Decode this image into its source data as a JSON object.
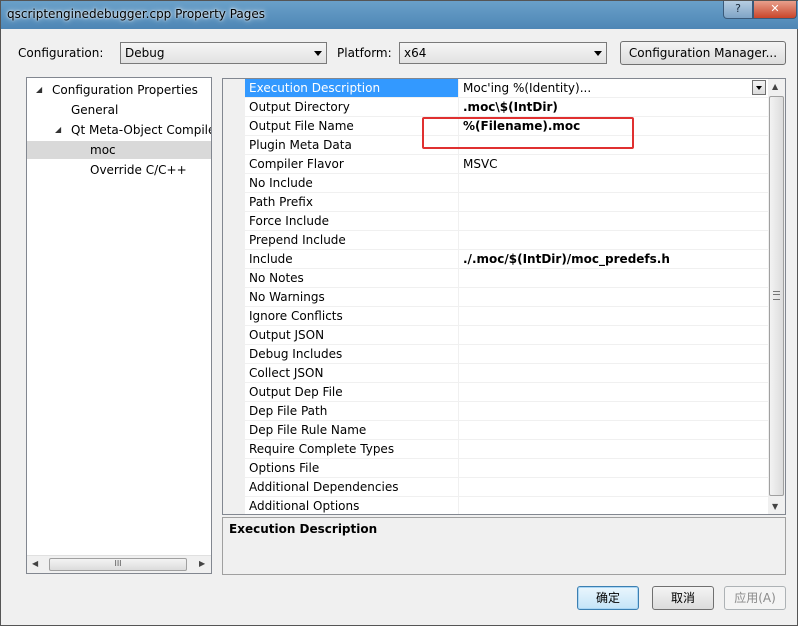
{
  "window": {
    "title": "qscriptenginedebugger.cpp Property Pages",
    "help_label": "?",
    "close_label": "✕"
  },
  "toolbar": {
    "configuration_label": "Configuration:",
    "configuration_value": "Debug",
    "platform_label": "Platform:",
    "platform_value": "x64",
    "config_manager_label": "Configuration Manager..."
  },
  "tree": {
    "items": [
      {
        "label": "Configuration Properties",
        "level": 0,
        "expanded": true,
        "selected": false
      },
      {
        "label": "General",
        "level": 1,
        "selected": false
      },
      {
        "label": "Qt Meta-Object Compile",
        "level": 1,
        "expanded": true,
        "selected": false
      },
      {
        "label": "moc",
        "level": 2,
        "selected": true
      },
      {
        "label": "Override C/C++",
        "level": 2,
        "selected": false
      }
    ],
    "scroll_grip": "III"
  },
  "properties": {
    "rows": [
      {
        "name": "Execution Description",
        "value": "Moc'ing %(Identity)...",
        "bold": false,
        "selected": true
      },
      {
        "name": "Output Directory",
        "value": ".moc\\$(IntDir)",
        "bold": true
      },
      {
        "name": "Output File Name",
        "value": "%(Filename).moc",
        "bold": true
      },
      {
        "name": "Plugin Meta Data",
        "value": "",
        "bold": false
      },
      {
        "name": "Compiler Flavor",
        "value": "MSVC",
        "bold": false
      },
      {
        "name": "No Include",
        "value": "",
        "bold": false
      },
      {
        "name": "Path Prefix",
        "value": "",
        "bold": false
      },
      {
        "name": "Force Include",
        "value": "",
        "bold": false
      },
      {
        "name": "Prepend Include",
        "value": "",
        "bold": false
      },
      {
        "name": "Include",
        "value": "./.moc/$(IntDir)/moc_predefs.h",
        "bold": true
      },
      {
        "name": "No Notes",
        "value": "",
        "bold": false
      },
      {
        "name": "No Warnings",
        "value": "",
        "bold": false
      },
      {
        "name": "Ignore Conflicts",
        "value": "",
        "bold": false
      },
      {
        "name": "Output JSON",
        "value": "",
        "bold": false
      },
      {
        "name": "Debug Includes",
        "value": "",
        "bold": false
      },
      {
        "name": "Collect JSON",
        "value": "",
        "bold": false
      },
      {
        "name": "Output Dep File",
        "value": "",
        "bold": false
      },
      {
        "name": "Dep File Path",
        "value": "",
        "bold": false
      },
      {
        "name": "Dep File Rule Name",
        "value": "",
        "bold": false
      },
      {
        "name": "Require Complete Types",
        "value": "",
        "bold": false
      },
      {
        "name": "Options File",
        "value": "",
        "bold": false
      },
      {
        "name": "Additional Dependencies",
        "value": "",
        "bold": false
      },
      {
        "name": "Additional Options",
        "value": "",
        "bold": false
      }
    ]
  },
  "description": {
    "title": "Execution Description"
  },
  "buttons": {
    "ok": "确定",
    "cancel": "取消",
    "apply": "应用(A)"
  },
  "colors": {
    "selection": "#3399ff",
    "highlight_box": "#e03030"
  }
}
